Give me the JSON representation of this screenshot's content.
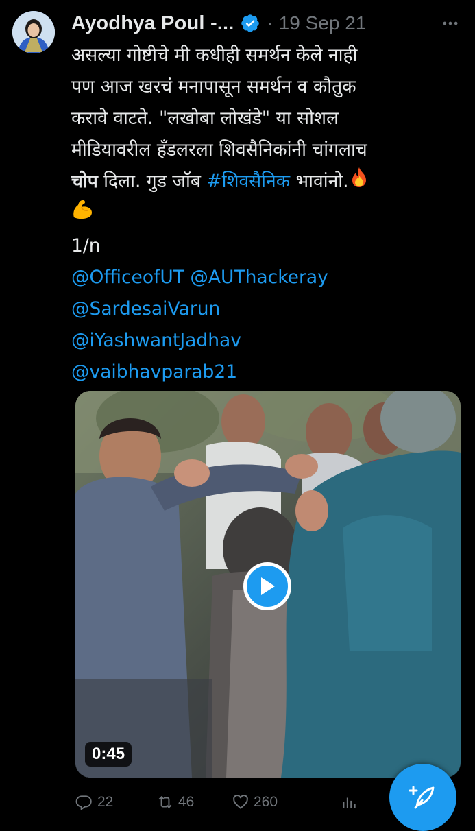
{
  "tweet": {
    "author_name": "Ayodhya Poul -...",
    "date": "· 19 Sep 21",
    "text_lines": {
      "l1": "असल्या गोष्टीचे मी कधीही समर्थन केले नाही",
      "l2": "पण आज खरचं मनापासून समर्थन व कौतुक",
      "l3": "करावे वाटते. \"लखोबा लोखंडे\" या सोशल",
      "l4": "मीडियावरील हँडलरला शिवसैनिकांनी चांगलाच",
      "l5_bold": "चोप",
      "l5_a": " दिला. गुड जॉब ",
      "l5_hashtag": "#शिवसैनिक",
      "l5_b": " भावांनो.",
      "l7": "1/n"
    },
    "mentions": {
      "m1": "@OfficeofUT",
      "m2": "@AUThackeray",
      "m3": "@SardesaiVarun",
      "m4": "@iYashwantJadhav",
      "m5": "@vaibhavparab21"
    },
    "emojis": [
      "fire-emoji",
      "flexed-biceps-emoji"
    ]
  },
  "media": {
    "type": "video",
    "duration": "0:45"
  },
  "actions": {
    "replies": "22",
    "retweets": "46",
    "likes": "260"
  },
  "colors": {
    "background": "#000000",
    "text": "#e7e9ea",
    "muted": "#71767b",
    "accent": "#1d9bf0"
  },
  "icons": [
    "more-icon",
    "verified-icon",
    "play-icon",
    "reply-icon",
    "retweet-icon",
    "like-icon",
    "analytics-icon",
    "compose-icon"
  ]
}
